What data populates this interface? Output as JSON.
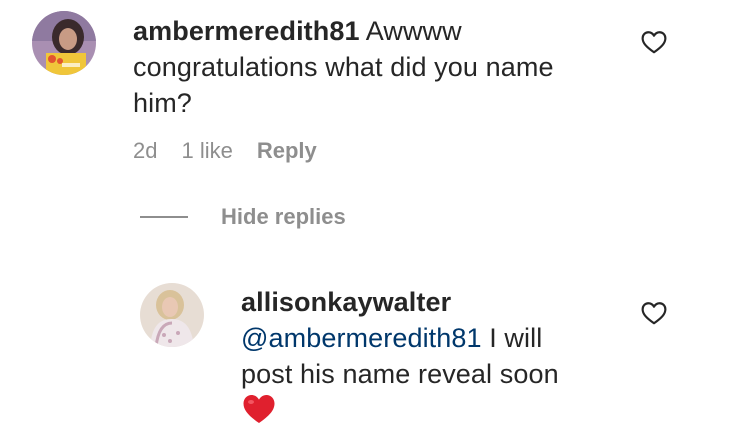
{
  "comments": [
    {
      "username": "ambermeredith81",
      "text_line1": " Awwww",
      "text_line2": "congratulations what did you name",
      "text_line3": "him?",
      "time": "2d",
      "likes": "1 like",
      "reply_label": "Reply"
    }
  ],
  "hide_replies_label": "Hide replies",
  "replies": [
    {
      "username": "allisonkaywalter",
      "mention": "@ambermeredith81",
      "text_line1_rest": " I will",
      "text_line2": "post his name reveal soon",
      "emoji": "heart-emoji"
    }
  ],
  "colors": {
    "text": "#262626",
    "muted": "#8e8e8e",
    "mention": "#00376b",
    "heart_emoji": "#e0202e"
  }
}
